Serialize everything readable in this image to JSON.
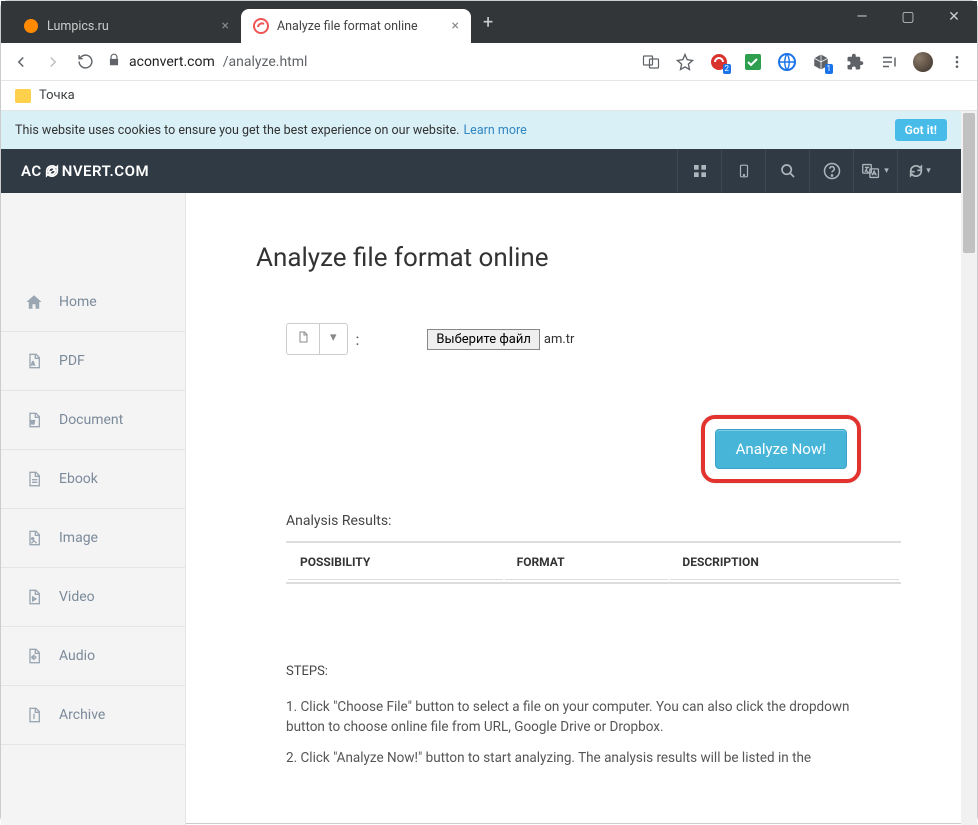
{
  "browser": {
    "tabs": [
      {
        "title": "Lumpics.ru",
        "active": false
      },
      {
        "title": "Analyze file format online",
        "active": true
      }
    ],
    "url_domain": "aconvert.com",
    "url_path": "/analyze.html",
    "bookmark": "Точка"
  },
  "cookie": {
    "text": "This website uses cookies to ensure you get the best experience on our website.",
    "link": "Learn more",
    "button": "Got it!"
  },
  "header": {
    "logo_pre": "AC",
    "logo_post": "NVERT.COM"
  },
  "sidebar": {
    "items": [
      {
        "label": "Home"
      },
      {
        "label": "PDF"
      },
      {
        "label": "Document"
      },
      {
        "label": "Ebook"
      },
      {
        "label": "Image"
      },
      {
        "label": "Video"
      },
      {
        "label": "Audio"
      },
      {
        "label": "Archive"
      }
    ]
  },
  "main": {
    "title": "Analyze file format online",
    "choose_file_label": "Выберите файл",
    "selected_file": "am.tr",
    "analyze_button": "Analyze Now!",
    "results_label": "Analysis Results:",
    "columns": {
      "c1": "POSSIBILITY",
      "c2": "FORMAT",
      "c3": "DESCRIPTION"
    },
    "steps_label": "STEPS:",
    "step1": "1. Click \"Choose File\" button to select a file on your computer. You can also click the dropdown button to choose online file from URL, Google Drive or Dropbox.",
    "step2": "2. Click \"Analyze Now!\" button to start analyzing. The analysis results will be listed in the"
  }
}
